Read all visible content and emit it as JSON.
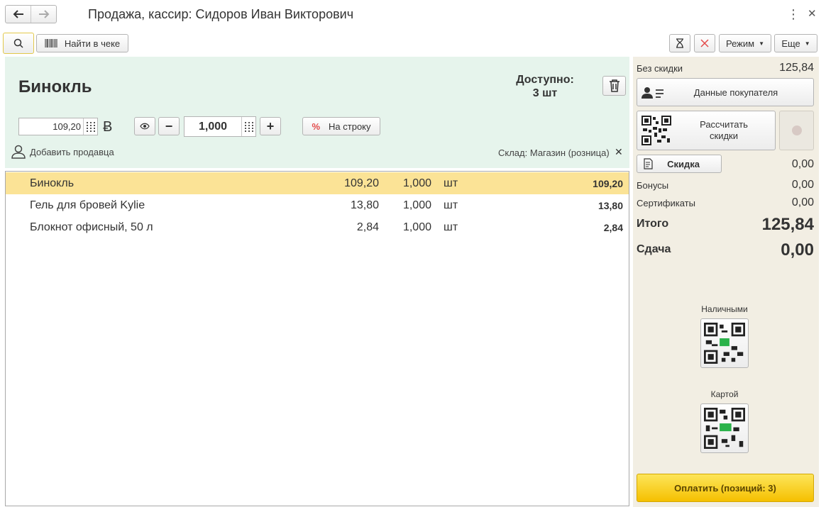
{
  "window": {
    "title": "Продажа, кассир: Сидоров Иван Викторович"
  },
  "toolbar": {
    "find_in_check": "Найти в чеке",
    "mode_label": "Режим",
    "more_label": "Еще"
  },
  "item": {
    "name": "Бинокль",
    "available_label": "Доступно:",
    "available_value": "3 шт",
    "price": "109,20",
    "currency_symbol": "Ƀ",
    "quantity": "1,000",
    "to_row_label": "На строку",
    "percent_symbol": "%",
    "add_seller": "Добавить продавца",
    "warehouse": "Склад: Магазин (розница)"
  },
  "rows": [
    {
      "name": "Бинокль",
      "price": "109,20",
      "qty": "1,000",
      "unit": "шт",
      "sum": "109,20",
      "selected": true
    },
    {
      "name": "Гель для бровей Kylie",
      "price": "13,80",
      "qty": "1,000",
      "unit": "шт",
      "sum": "13,80",
      "selected": false
    },
    {
      "name": "Блокнот офисный, 50 л",
      "price": "2,84",
      "qty": "1,000",
      "unit": "шт",
      "sum": "2,84",
      "selected": false
    }
  ],
  "summary": {
    "no_discount_label": "Без скидки",
    "no_discount_value": "125,84",
    "customer_button": "Данные покупателя",
    "calc_discount_line1": "Рассчитать",
    "calc_discount_line2": "скидки",
    "discount_button": "Скидка",
    "discount_value": "0,00",
    "bonus_label": "Бонусы",
    "bonus_value": "0,00",
    "certificates_label": "Сертификаты",
    "certificates_value": "0,00",
    "total_label": "Итого",
    "total_value": "125,84",
    "change_label": "Сдача",
    "change_value": "0,00"
  },
  "payment": {
    "cash_label": "Наличными",
    "card_label": "Картой",
    "pay_button": "Оплатить (позиций: 3)"
  },
  "colors": {
    "header_panel": "#e6f4ec",
    "right_panel": "#f2eee3",
    "selected_row": "#fbe396",
    "pay_button": "#f5c000",
    "qr_accent": "#2ab24a"
  }
}
